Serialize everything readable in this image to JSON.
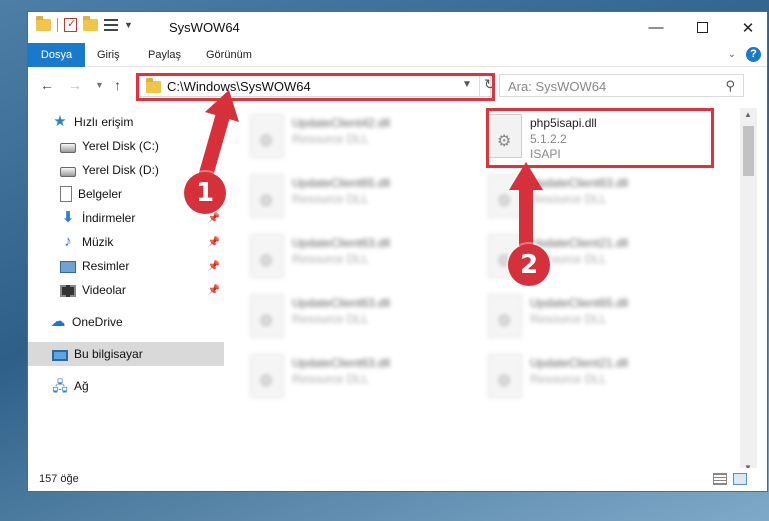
{
  "window": {
    "title": "SysWOW64",
    "controls": {
      "minimize": "—",
      "close": "✕"
    }
  },
  "ribbon": {
    "tabs": [
      "Dosya",
      "Giriş",
      "Paylaş",
      "Görünüm"
    ],
    "help": "?"
  },
  "nav": {
    "address": "C:\\Windows\\SysWOW64",
    "search_placeholder": "Ara: SysWOW64"
  },
  "sidebar": {
    "items": [
      {
        "label": "Hızlı erişim",
        "icon": "star-icon"
      },
      {
        "label": "Yerel Disk (C:)",
        "icon": "drive-icon"
      },
      {
        "label": "Yerel Disk (D:)",
        "icon": "drive-icon"
      },
      {
        "label": "Belgeler",
        "icon": "documents-icon"
      },
      {
        "label": "İndirmeler",
        "icon": "download-icon"
      },
      {
        "label": "Müzik",
        "icon": "music-icon"
      },
      {
        "label": "Resimler",
        "icon": "pictures-icon"
      },
      {
        "label": "Videolar",
        "icon": "videos-icon"
      },
      {
        "label": "OneDrive",
        "icon": "cloud-icon"
      },
      {
        "label": "Bu bilgisayar",
        "icon": "computer-icon"
      },
      {
        "label": "Ağ",
        "icon": "network-icon"
      }
    ]
  },
  "files": {
    "highlighted": {
      "name": "php5isapi.dll",
      "version": "5.1.2.2",
      "description": "ISAPI"
    },
    "col1": [
      {
        "name": "UpdateClient42.dll",
        "type": "Resource DLL"
      },
      {
        "name": "UpdateClient65.dll",
        "type": "Resource DLL"
      },
      {
        "name": "UpdateClient63.dll",
        "type": "Resource DLL"
      },
      {
        "name": "UpdateClient63.dll",
        "type": "Resource DLL"
      },
      {
        "name": "UpdateClient63.dll",
        "type": "Resource DLL"
      }
    ],
    "col2": [
      {
        "name": "UpdateClient63.dll",
        "type": "Resource DLL"
      },
      {
        "name": "UpdateClient21.dll",
        "type": "Resource DLL"
      },
      {
        "name": "UpdateClient65.dll",
        "type": "Resource DLL"
      },
      {
        "name": "UpdateClient21.dll",
        "type": "Resource DLL"
      }
    ]
  },
  "status": {
    "count": "157 öğe"
  },
  "annotations": {
    "step1": "1",
    "step2": "2",
    "color": "#d6303a"
  }
}
